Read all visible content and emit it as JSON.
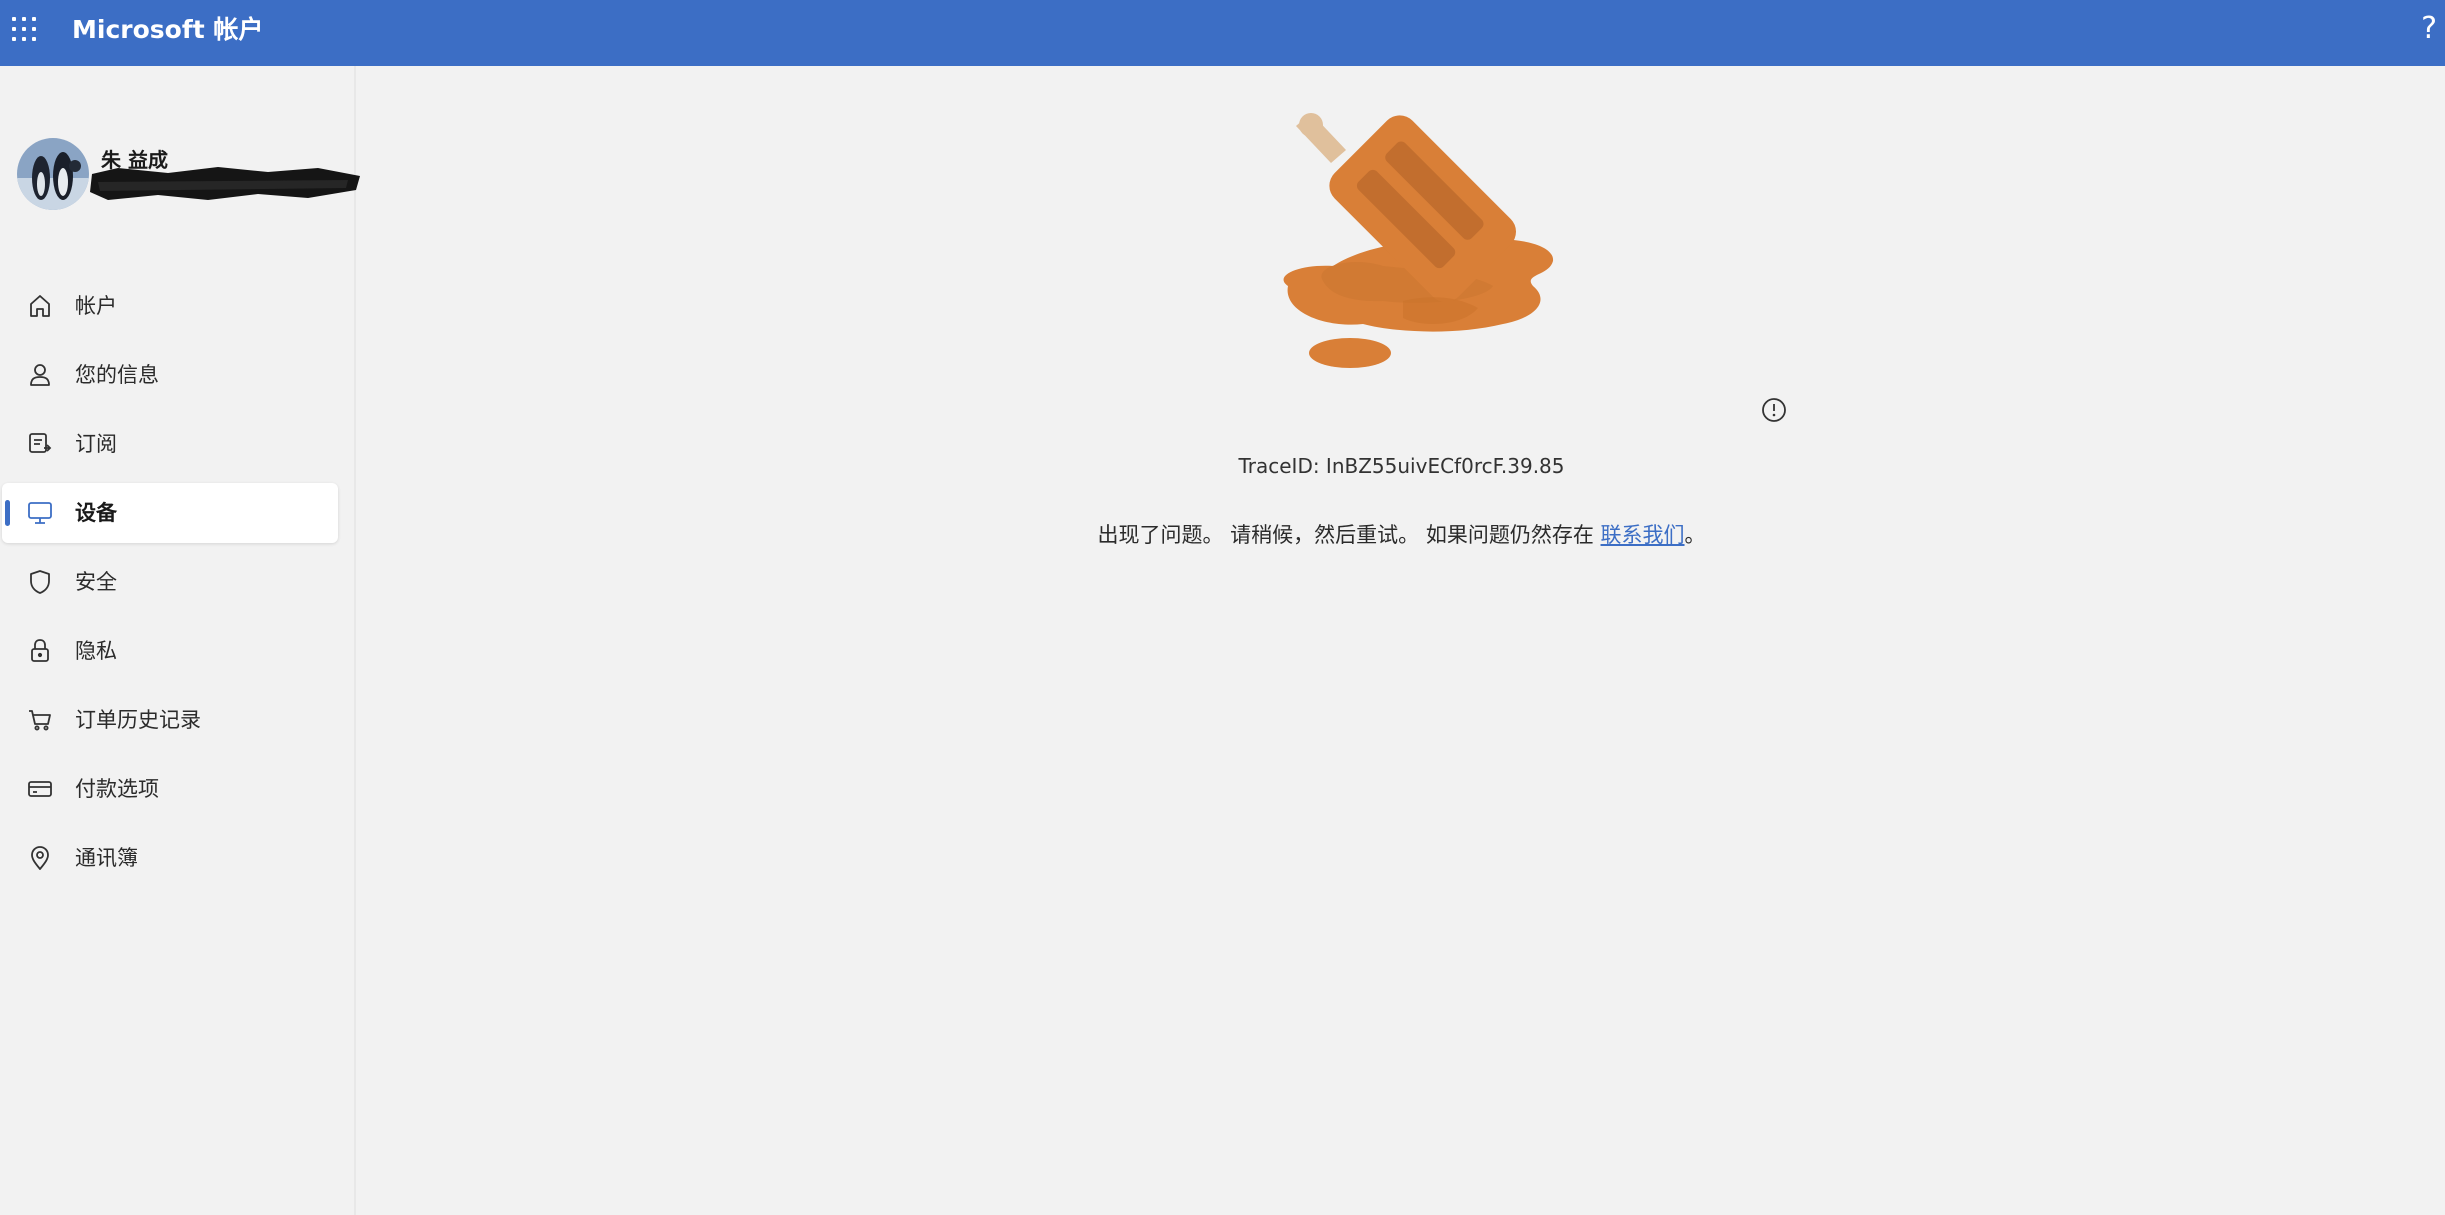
{
  "header": {
    "app_title": "Microsoft 帐户",
    "help_label": "?",
    "background_color": "#3c6ec5"
  },
  "profile": {
    "name": "朱 益成",
    "email_redacted": true
  },
  "sidebar": {
    "items": [
      {
        "label": "帐户",
        "icon": "home-icon",
        "active": false
      },
      {
        "label": "您的信息",
        "icon": "person-icon",
        "active": false
      },
      {
        "label": "订阅",
        "icon": "subscription-icon",
        "active": false
      },
      {
        "label": "设备",
        "icon": "monitor-icon",
        "active": true
      },
      {
        "label": "安全",
        "icon": "shield-icon",
        "active": false
      },
      {
        "label": "隐私",
        "icon": "lock-icon",
        "active": false
      },
      {
        "label": "订单历史记录",
        "icon": "cart-icon",
        "active": false
      },
      {
        "label": "付款选项",
        "icon": "credit-card-icon",
        "active": false
      },
      {
        "label": "通讯簿",
        "icon": "location-pin-icon",
        "active": false
      }
    ]
  },
  "error": {
    "trace_id": "TraceID: InBZ55uivECf0rcF.39.85",
    "message": "出现了问题。 请稍候，然后重试。 如果问题仍然存在 ",
    "link_label": "联系我们",
    "message_end": "。",
    "illustration": "melted-popsicle-illustration",
    "illustration_color": "#d77f3a"
  }
}
